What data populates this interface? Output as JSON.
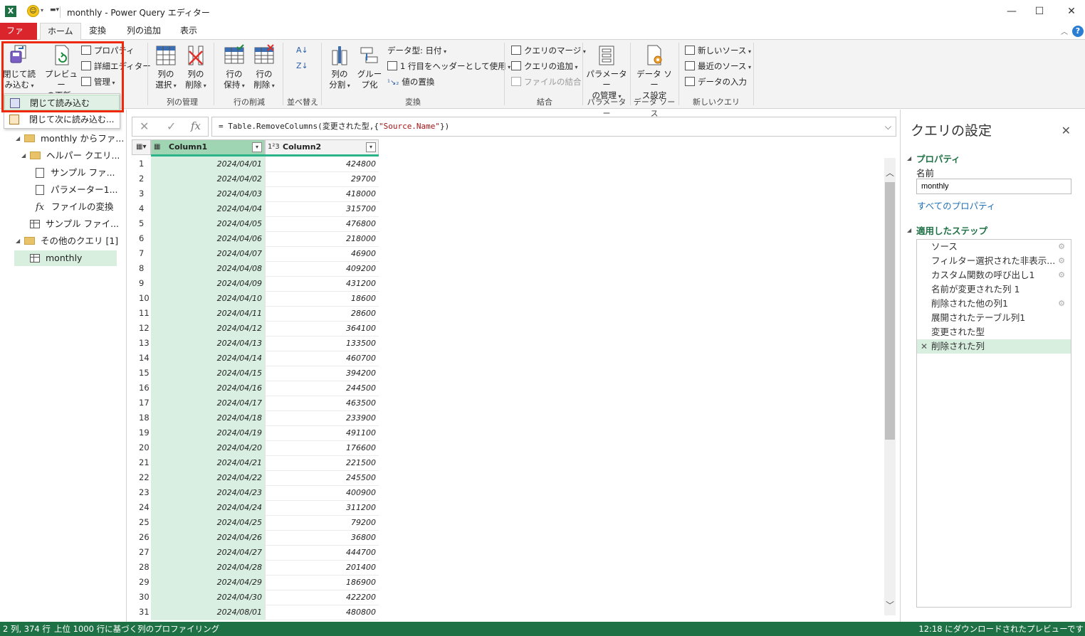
{
  "window": {
    "title": "monthly - Power Query エディター",
    "app_icon": "excel-icon",
    "minimize": "—",
    "maximize": "☐",
    "close": "✕"
  },
  "tabs": [
    {
      "label": "ファイル"
    },
    {
      "label": "ホーム"
    },
    {
      "label": "変換"
    },
    {
      "label": "列の追加"
    },
    {
      "label": "表示"
    }
  ],
  "ribbon": {
    "close_load": {
      "line1": "閉じて読",
      "line2": "み込む"
    },
    "refresh_preview": {
      "line1": "プレビュー",
      "line2": "の更新"
    },
    "properties": "プロパティ",
    "advanced_editor": "詳細エディター",
    "manage": "管理",
    "choose_columns": {
      "line1": "列の",
      "line2": "選択"
    },
    "remove_columns": {
      "line1": "列の",
      "line2": "削除"
    },
    "column_group": "列の管理",
    "keep_rows": {
      "line1": "行の",
      "line2": "保持"
    },
    "remove_rows": {
      "line1": "行の",
      "line2": "削除"
    },
    "rows_group": "行の削減",
    "sort_group": "並べ替え",
    "split_column": {
      "line1": "列の",
      "line2": "分割"
    },
    "group_by": {
      "line1": "グルー",
      "line2": "プ化"
    },
    "data_type": "データ型: 日付",
    "first_row_header": "1 行目をヘッダーとして使用",
    "replace_values": "値の置換",
    "transform_group": "変換",
    "merge_queries": "クエリのマージ",
    "append_queries": "クエリの追加",
    "combine_files": "ファイルの結合",
    "combine_group": "結合",
    "manage_params": {
      "line1": "パラメーター",
      "line2": "の管理"
    },
    "params_group": "パラメーター",
    "data_source_settings": {
      "line1": "データ ソー",
      "line2": "ス設定"
    },
    "data_source_group": "データ ソース",
    "new_source": "新しいソース",
    "recent_sources": "最近のソース",
    "enter_data": "データの入力",
    "new_query_group": "新しいクエリ"
  },
  "dropdown": {
    "close_load": "閉じて読み込む",
    "close_load_to": "閉じて次に読み込む..."
  },
  "queries": [
    {
      "label": "monthly からファ...",
      "type": "folder"
    },
    {
      "label": "ヘルパー クエリ...",
      "type": "folder"
    },
    {
      "label": "サンプル ファ...",
      "type": "doc"
    },
    {
      "label": "パラメーター1...",
      "type": "param"
    },
    {
      "label": "ファイルの変換",
      "type": "fx"
    },
    {
      "label": "サンプル ファイ...",
      "type": "table"
    },
    {
      "label": "その他のクエリ [1]",
      "type": "folder"
    },
    {
      "label": "monthly",
      "type": "table"
    }
  ],
  "formula": {
    "prefix": "= Table.RemoveColumns(変更された型,{",
    "string": "\"Source.Name\"",
    "suffix": "})"
  },
  "grid": {
    "columns": [
      {
        "name": "Column1",
        "type_icon": "calendar-icon"
      },
      {
        "name": "Column2",
        "type_icon": "1²3"
      }
    ],
    "rows": [
      [
        "2024/04/01",
        "424800"
      ],
      [
        "2024/04/02",
        "29700"
      ],
      [
        "2024/04/03",
        "418000"
      ],
      [
        "2024/04/04",
        "315700"
      ],
      [
        "2024/04/05",
        "476800"
      ],
      [
        "2024/04/06",
        "218000"
      ],
      [
        "2024/04/07",
        "46900"
      ],
      [
        "2024/04/08",
        "409200"
      ],
      [
        "2024/04/09",
        "431200"
      ],
      [
        "2024/04/10",
        "18600"
      ],
      [
        "2024/04/11",
        "28600"
      ],
      [
        "2024/04/12",
        "364100"
      ],
      [
        "2024/04/13",
        "133500"
      ],
      [
        "2024/04/14",
        "460700"
      ],
      [
        "2024/04/15",
        "394200"
      ],
      [
        "2024/04/16",
        "244500"
      ],
      [
        "2024/04/17",
        "463500"
      ],
      [
        "2024/04/18",
        "233900"
      ],
      [
        "2024/04/19",
        "491100"
      ],
      [
        "2024/04/20",
        "176600"
      ],
      [
        "2024/04/21",
        "221500"
      ],
      [
        "2024/04/22",
        "245500"
      ],
      [
        "2024/04/23",
        "400900"
      ],
      [
        "2024/04/24",
        "311200"
      ],
      [
        "2024/04/25",
        "79200"
      ],
      [
        "2024/04/26",
        "36800"
      ],
      [
        "2024/04/27",
        "444700"
      ],
      [
        "2024/04/28",
        "201400"
      ],
      [
        "2024/04/29",
        "186900"
      ],
      [
        "2024/04/30",
        "422200"
      ],
      [
        "2024/08/01",
        "480800"
      ]
    ]
  },
  "query_settings": {
    "title": "クエリの設定",
    "properties_header": "プロパティ",
    "name_label": "名前",
    "name_value": "monthly",
    "all_properties": "すべてのプロパティ",
    "steps_header": "適用したステップ",
    "steps": [
      {
        "label": "ソース",
        "gear": true
      },
      {
        "label": "フィルター選択された非表示...",
        "gear": true
      },
      {
        "label": "カスタム関数の呼び出し1",
        "gear": true
      },
      {
        "label": "名前が変更された列 1",
        "gear": false
      },
      {
        "label": "削除された他の列1",
        "gear": true
      },
      {
        "label": "展開されたテーブル列1",
        "gear": false
      },
      {
        "label": "変更された型",
        "gear": false
      },
      {
        "label": "削除された列",
        "gear": false,
        "selected": true
      }
    ]
  },
  "status": {
    "left": "2 列, 374 行",
    "middle": "上位 1000 行に基づく列のプロファイリング",
    "right": "12:18 にダウンロードされたプレビューです"
  },
  "colors": {
    "file_tab": "#d9252b",
    "status_bar": "#1e7145",
    "highlight": "#f0280a",
    "selected_column": "#9fd5b2"
  }
}
